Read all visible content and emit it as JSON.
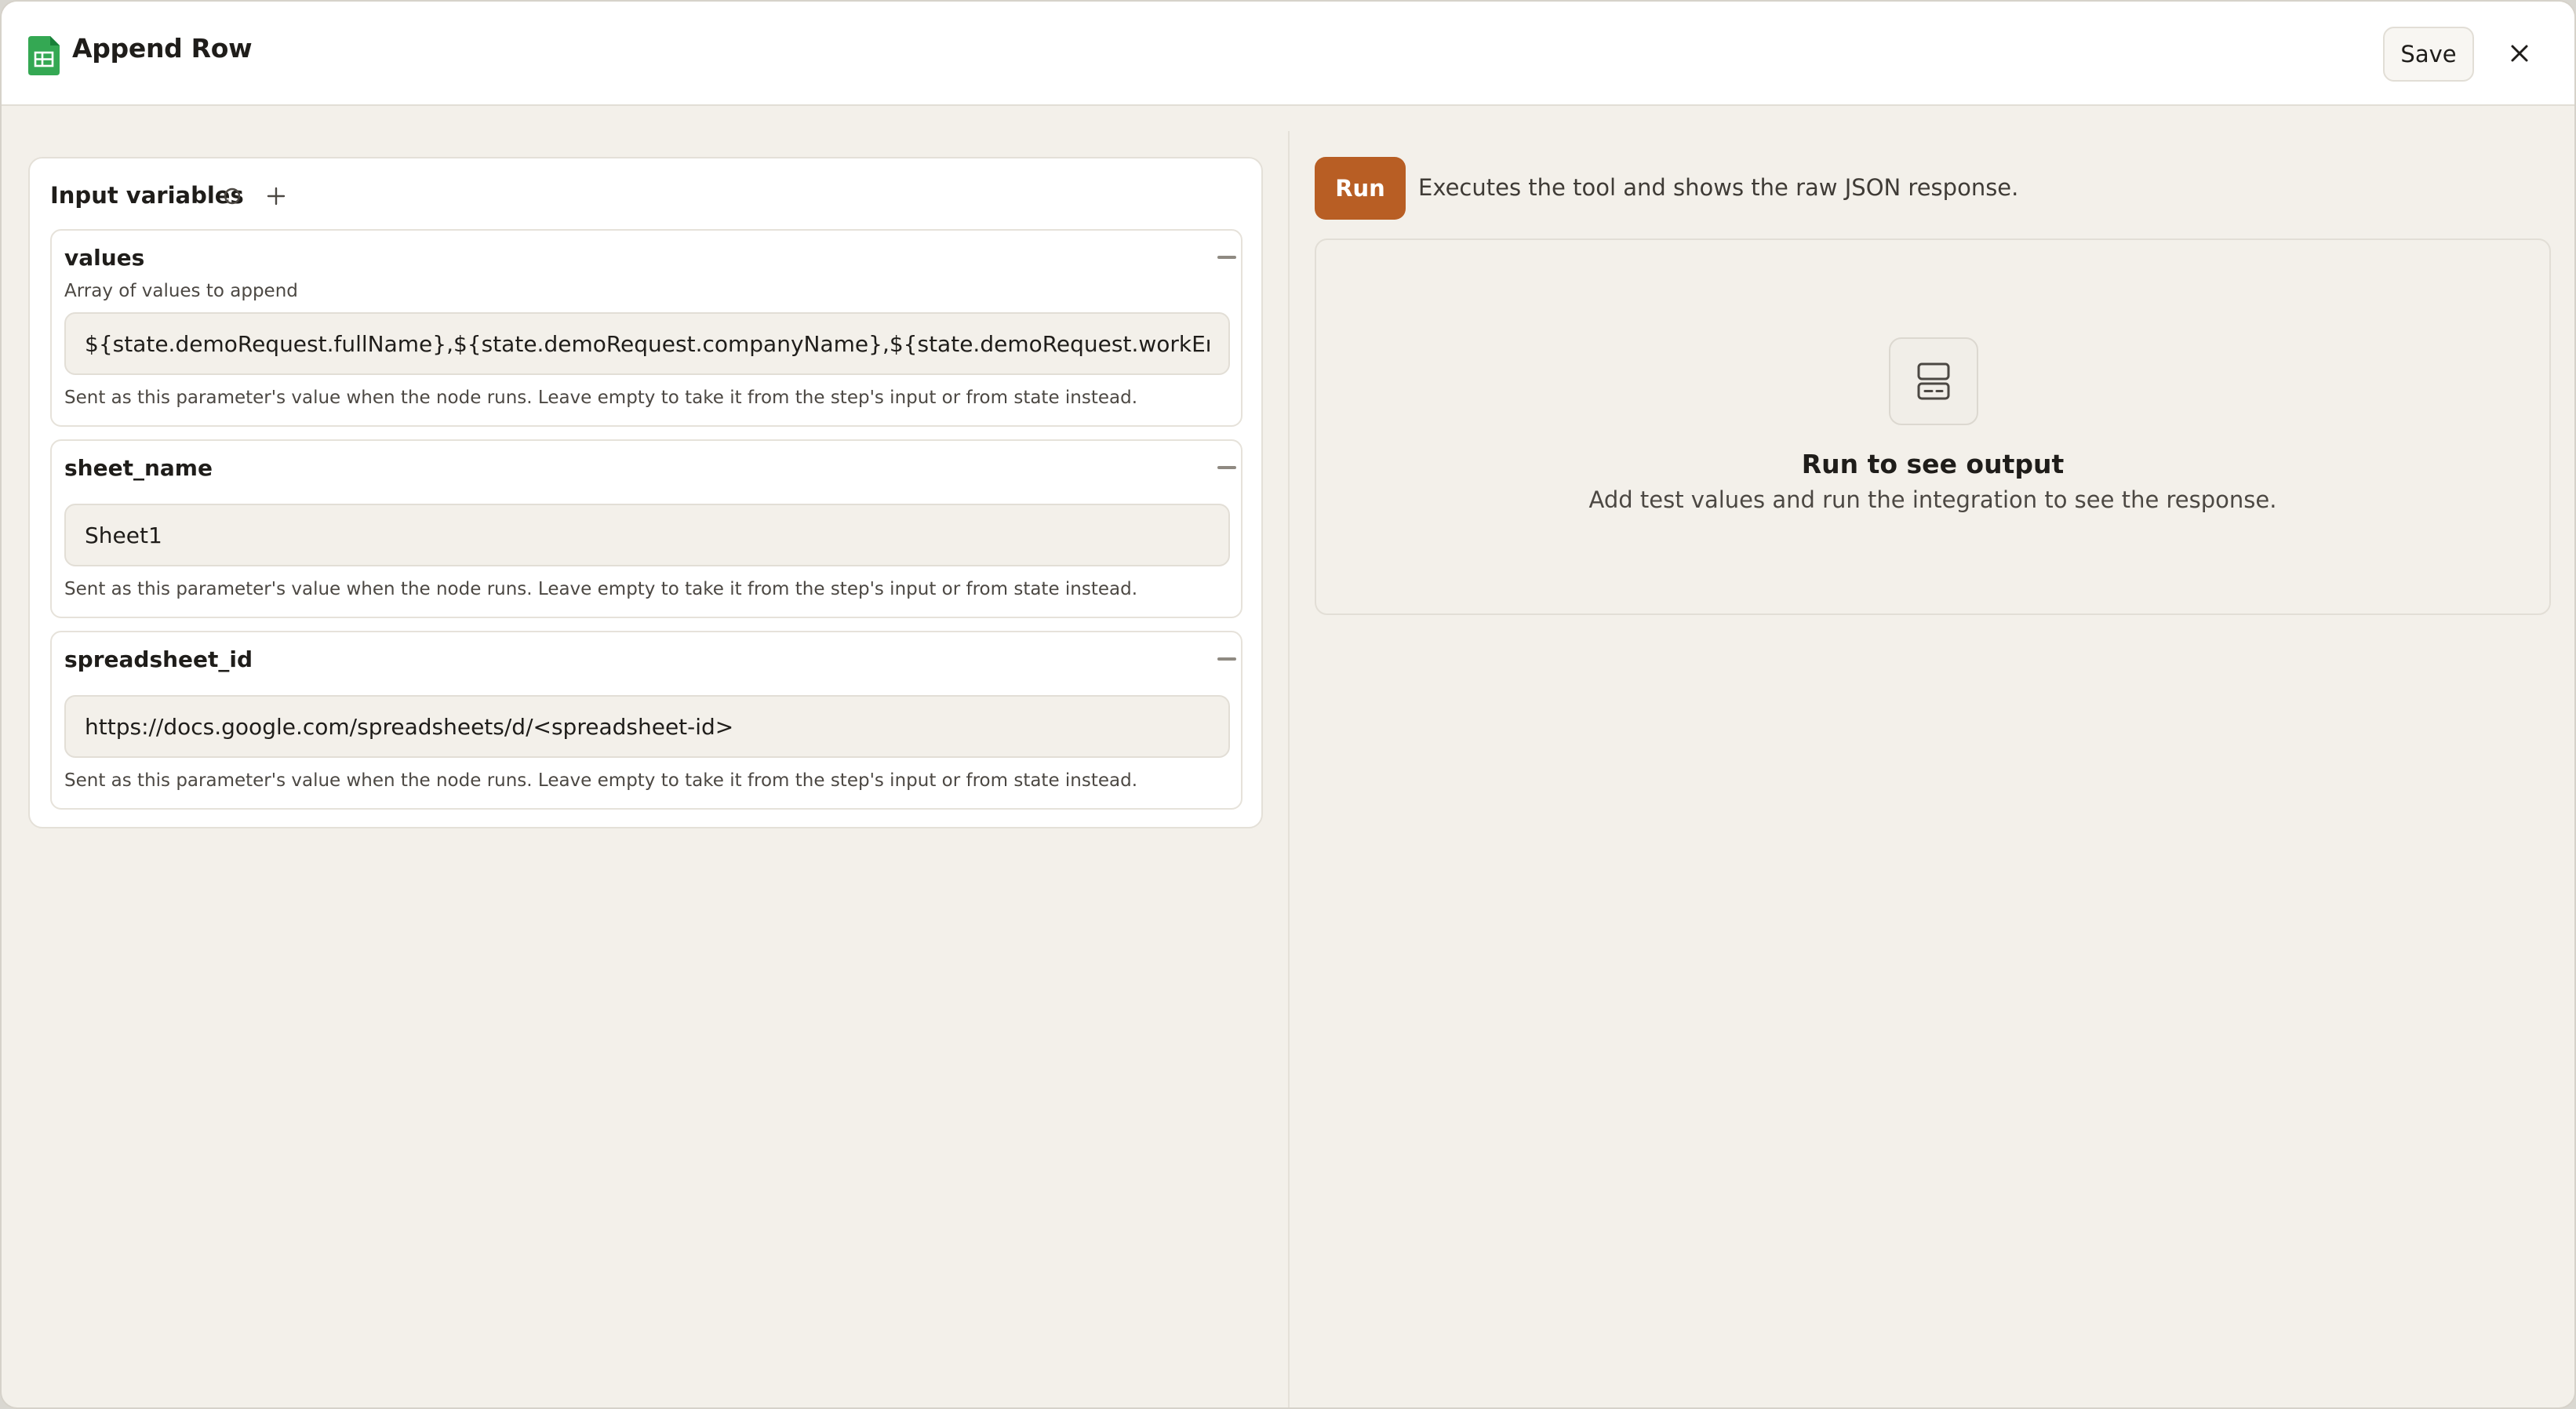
{
  "header": {
    "title": "Append Row",
    "save_label": "Save",
    "app_icon": "google-sheets-icon",
    "brand_color": "#34a853"
  },
  "input_variables": {
    "title": "Input variables",
    "items": [
      {
        "name": "values",
        "description": "Array of values to append",
        "value": "${state.demoRequest.fullName},${state.demoRequest.companyName},${state.demoRequest.workEmail},${s",
        "hint": "Sent as this parameter's value when the node runs. Leave empty to take it from the step's input or from state instead."
      },
      {
        "name": "sheet_name",
        "value": "Sheet1",
        "hint": "Sent as this parameter's value when the node runs. Leave empty to take it from the step's input or from state instead."
      },
      {
        "name": "spreadsheet_id",
        "value": "https://docs.google.com/spreadsheets/d/<spreadsheet-id>",
        "hint": "Sent as this parameter's value when the node runs. Leave empty to take it from the step's input or from state instead."
      }
    ]
  },
  "run": {
    "label": "Run",
    "description": "Executes the tool and shows the raw JSON response.",
    "accent_color": "#b85e24"
  },
  "output": {
    "title": "Run to see output",
    "subtitle": "Add test values and run the integration to see the response."
  }
}
